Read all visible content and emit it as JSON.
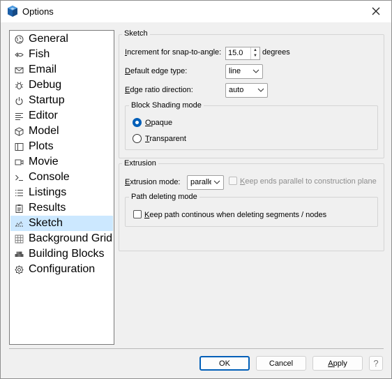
{
  "window": {
    "title": "Options"
  },
  "nav": {
    "items": [
      {
        "label": "General",
        "icon": "globe-icon"
      },
      {
        "label": "Fish",
        "icon": "fish-icon"
      },
      {
        "label": "Email",
        "icon": "envelope-icon"
      },
      {
        "label": "Debug",
        "icon": "bug-icon"
      },
      {
        "label": "Startup",
        "icon": "power-icon"
      },
      {
        "label": "Editor",
        "icon": "lines-icon"
      },
      {
        "label": "Model",
        "icon": "cube-icon"
      },
      {
        "label": "Plots",
        "icon": "plot-icon"
      },
      {
        "label": "Movie",
        "icon": "movie-icon"
      },
      {
        "label": "Console",
        "icon": "console-icon"
      },
      {
        "label": "Listings",
        "icon": "list-icon"
      },
      {
        "label": "Results",
        "icon": "clipboard-icon"
      },
      {
        "label": "Sketch",
        "icon": "sketch-icon"
      },
      {
        "label": "Background Grid",
        "icon": "grid-icon"
      },
      {
        "label": "Building Blocks",
        "icon": "blocks-icon"
      },
      {
        "label": "Configuration",
        "icon": "gear-icon"
      }
    ],
    "selected": "Sketch"
  },
  "sketch": {
    "group_title": "Sketch",
    "snap_label_u": "I",
    "snap_label_rest": "ncrement for snap-to-angle:",
    "snap_value": "15.0",
    "snap_unit": "degrees",
    "edge_type_label_u": "D",
    "edge_type_label_rest": "efault edge type:",
    "edge_type_value": "line",
    "edge_ratio_label_u": "E",
    "edge_ratio_label_rest": "dge ratio direction:",
    "edge_ratio_value": "auto",
    "shading": {
      "title": "Block Shading mode",
      "opaque_u": "O",
      "opaque_rest": "paque",
      "transparent_u": "T",
      "transparent_rest": "ransparent",
      "selected": "Opaque"
    }
  },
  "extrusion": {
    "group_title": "Extrusion",
    "mode_label_u": "E",
    "mode_label_rest": "xtrusion mode:",
    "mode_value": "parallel",
    "keep_ends_u": "K",
    "keep_ends_rest": "eep ends parallel to construction plane",
    "keep_ends_checked": false,
    "path_deleting": {
      "title": "Path deleting mode",
      "keep_path_u": "K",
      "keep_path_rest": "eep path continous when deleting segments / nodes",
      "keep_path_checked": false
    }
  },
  "buttons": {
    "ok": "OK",
    "cancel": "Cancel",
    "apply_u": "A",
    "apply_rest": "pply",
    "help": "?"
  },
  "colors": {
    "accent": "#005fb8",
    "selection": "#cce8ff"
  }
}
